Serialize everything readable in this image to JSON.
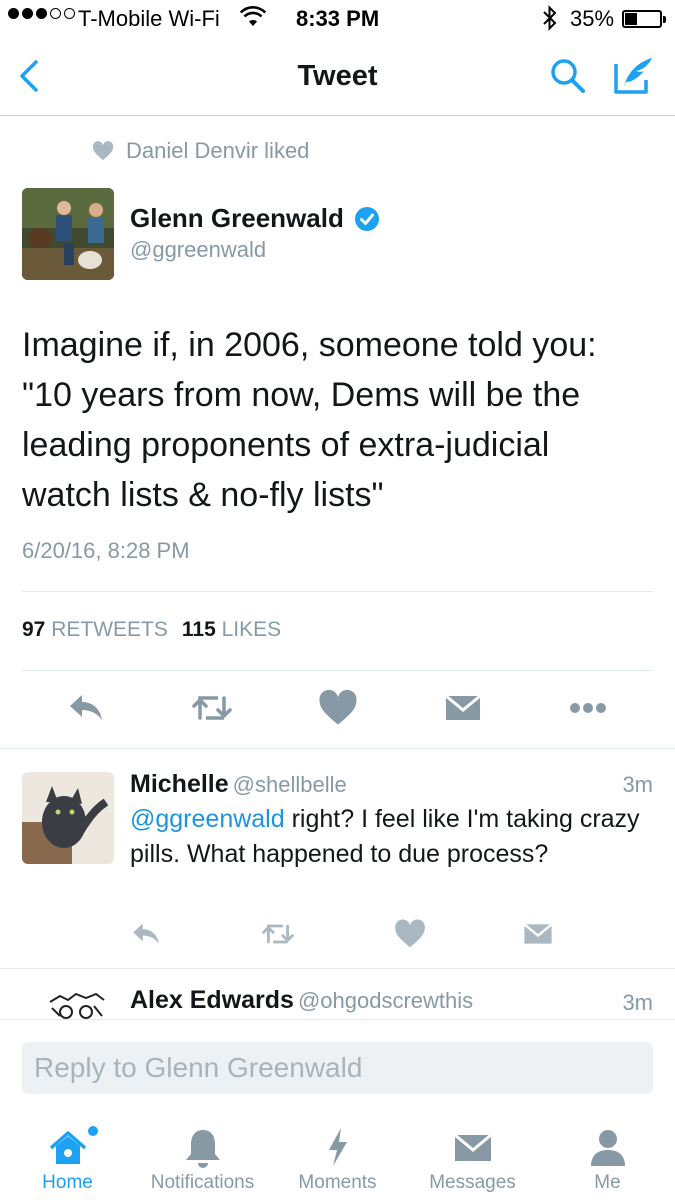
{
  "status_bar": {
    "carrier": "T-Mobile Wi-Fi",
    "time": "8:33 PM",
    "battery": "35%",
    "battery_level": 0.35
  },
  "nav": {
    "title": "Tweet",
    "back_icon": "chevron-left-icon",
    "search_icon": "search-icon",
    "compose_icon": "compose-icon"
  },
  "social_context": {
    "text": "Daniel Denvir liked"
  },
  "tweet": {
    "author_name": "Glenn Greenwald",
    "author_handle": "@ggreenwald",
    "verified": true,
    "text": "Imagine if, in 2006, someone told you:\n\"10 years from now, Dems will be the\nleading proponents of extra-judicial\nwatch lists & no-fly lists\"",
    "timestamp": "6/20/16, 8:28 PM",
    "retweet_count": "97",
    "retweet_label": "RETWEETS",
    "like_count": "115",
    "like_label": "LIKES"
  },
  "replies": [
    {
      "name": "Michelle",
      "handle": "@shellbelle",
      "age": "3m",
      "mention": "@ggreenwald",
      "text": " right? I feel like I'm taking crazy pills. What happened to due process?"
    },
    {
      "name": "Alex Edwards",
      "handle": "@ohgodscrewthis",
      "age": "3m"
    }
  ],
  "reply_box": {
    "placeholder": "Reply to Glenn Greenwald"
  },
  "tabs": [
    {
      "label": "Home",
      "icon": "home-icon",
      "active": true
    },
    {
      "label": "Notifications",
      "icon": "bell-icon",
      "active": false
    },
    {
      "label": "Moments",
      "icon": "lightning-icon",
      "active": false
    },
    {
      "label": "Messages",
      "icon": "envelope-icon",
      "active": false
    },
    {
      "label": "Me",
      "icon": "person-icon",
      "active": false
    }
  ],
  "colors": {
    "accent": "#1da1f2",
    "muted": "#8899a6",
    "text": "#14171a",
    "divider": "#e1e8ed"
  }
}
